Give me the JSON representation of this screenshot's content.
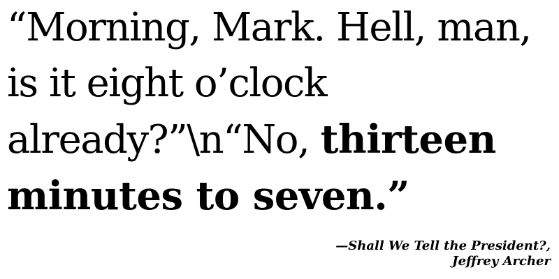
{
  "quote": {
    "normal_text": "“Morning, Mark. Hell, man, is it eight o’clock already?”\\n“No, ",
    "bold_text": "thirteen minutes to seven.”"
  },
  "attribution": {
    "line1": "—Shall We Tell the President?,",
    "line2": "Jeffrey Archer"
  }
}
